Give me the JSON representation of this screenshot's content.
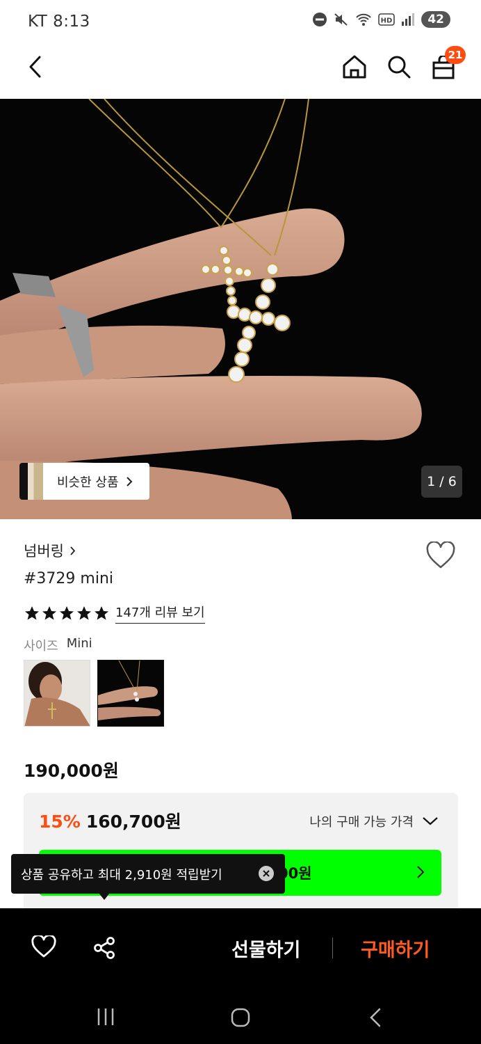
{
  "status_bar": {
    "carrier_time": "KT 8:13",
    "battery": "42"
  },
  "top_nav": {
    "cart_count": "21"
  },
  "hero": {
    "similar_label": "비슷한 상품",
    "page_counter": "1 / 6"
  },
  "product": {
    "brand": "넘버링",
    "title": "#3729 mini",
    "rating_stars": 5,
    "review_link": "147개 리뷰 보기",
    "size_label": "사이즈",
    "size_value": "Mini"
  },
  "pricing": {
    "original_price": "190,000원",
    "discount_rate": "15%",
    "sale_price": "160,700원",
    "my_price_label": "나의 구매 가능 가격",
    "green_button_text": "00원"
  },
  "tooltip": {
    "text": "상품 공유하고 최대 2,910원 적립받기"
  },
  "bottom_bar": {
    "gift_label": "선물하기",
    "buy_label": "구매하기"
  },
  "colors": {
    "accent_orange": "#ff4d12",
    "promo_green": "#00ff00"
  }
}
